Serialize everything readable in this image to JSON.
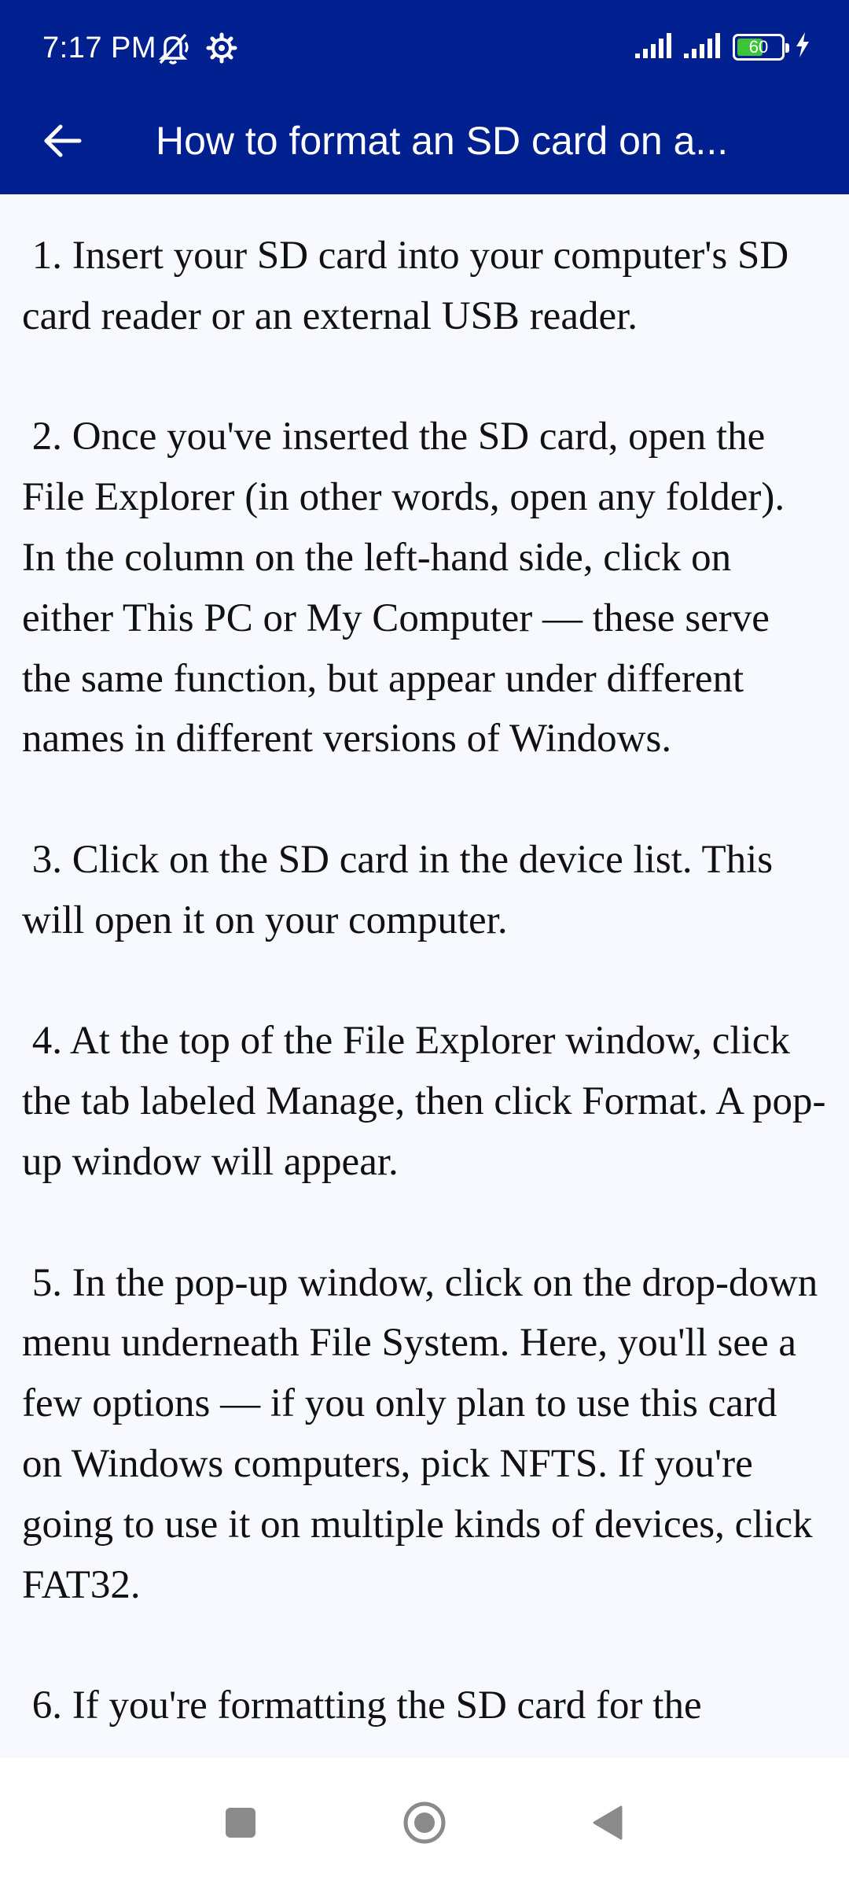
{
  "status_bar": {
    "time": "7:17 PM",
    "battery_level": "60",
    "battery_fraction": 0.6,
    "battery_color": "#3ec43a",
    "background_color": "#00208f",
    "icons_left": [
      "mute-icon",
      "settings-gear-icon"
    ],
    "icons_right": [
      "signal-icon",
      "signal-icon",
      "battery-icon",
      "charging-icon"
    ]
  },
  "app_bar": {
    "back_icon": "arrow-left-icon",
    "title": "How to format an SD card on a..."
  },
  "article": {
    "steps": [
      " 1. Insert your SD card into your computer's SD card reader or an external USB reader.",
      " 2. Once you've inserted the SD card, open the File Explorer (in other words, open any folder). In the column on the left-hand side, click on either This PC or My Computer — these serve the same function, but appear under different names in different versions of Windows.",
      " 3. Click on the SD card in the device list. This will open it on your computer.",
      " 4. At the top of the File Explorer window, click the tab labeled Manage, then click Format. A pop-up window will appear.",
      " 5. In the pop-up window, click on the drop-down menu underneath File System. Here, you'll see a few options — if you only plan to use this card on Windows computers, pick NFTS. If you're going to use it on multiple kinds of devices, click FAT32.",
      " 6. If you're formatting the SD card for the"
    ]
  },
  "nav_bar": {
    "recents_icon": "square-recents-icon",
    "home_icon": "circle-home-icon",
    "back_icon": "triangle-back-icon"
  }
}
